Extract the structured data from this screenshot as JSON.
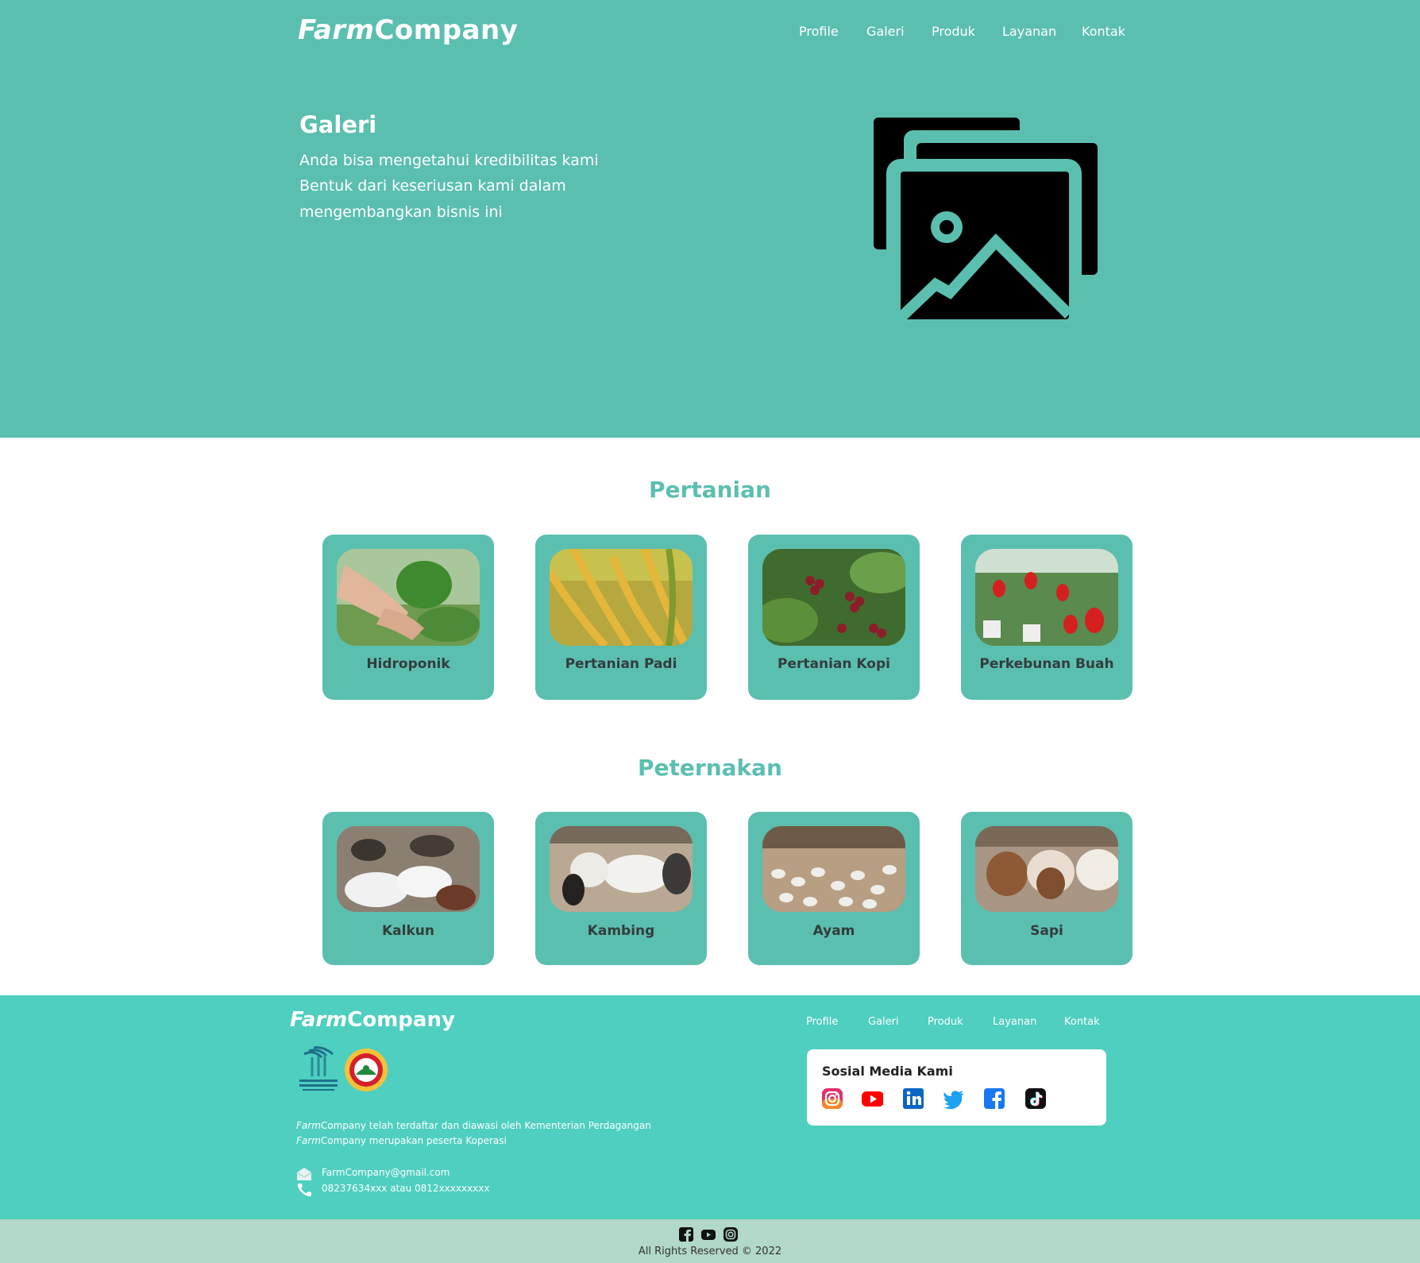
{
  "header": {
    "logo_part1": "Farm",
    "logo_part2": "Company",
    "nav": [
      "Profile",
      "Galeri",
      "Produk",
      "Layanan",
      "Kontak"
    ]
  },
  "hero": {
    "title": "Galeri",
    "lines": [
      "Anda bisa mengetahui kredibilitas kami",
      "Bentuk dari keseriusan kami dalam",
      "mengembangkan bisnis ini"
    ],
    "icon": "gallery-images-icon"
  },
  "sections": {
    "pertanian": {
      "title": "Pertanian",
      "items": [
        "Hidroponik",
        "Pertanian Padi",
        "Pertanian Kopi",
        "Perkebunan Buah"
      ]
    },
    "peternakan": {
      "title": "Peternakan",
      "items": [
        "Kalkun",
        "Kambing",
        "Ayam",
        "Sapi"
      ]
    }
  },
  "footer": {
    "logo_part1": "Farm",
    "logo_part2": "Company",
    "nav": [
      "Profile",
      "Galeri",
      "Produk",
      "Layanan",
      "Kontak"
    ],
    "registration": [
      {
        "brand1": "Farm",
        "brand2": "Company",
        "text": " telah terdaftar dan diawasi oleh Kementerian Perdagangan"
      },
      {
        "brand1": "Farm",
        "brand2": "Company",
        "text": " merupakan peserta Koperasi"
      }
    ],
    "email": "FarmCompany@gmail.com",
    "phone": "08237634xxx atau 0812xxxxxxxxx",
    "social_title": "Sosial Media Kami",
    "social_icons": [
      "instagram-icon",
      "youtube-icon",
      "linkedin-icon",
      "twitter-icon",
      "facebook-icon",
      "tiktok-icon"
    ],
    "bottom_icons": [
      "facebook-icon",
      "youtube-icon",
      "instagram-icon"
    ],
    "copyright": "All Rights Reserved © 2022"
  },
  "colors": {
    "hero_bg": "#5bbfb0",
    "footer_bg": "#4ecfbf",
    "bottom_bar_bg": "#b1d8c8",
    "section_title": "#5bbfb0"
  }
}
